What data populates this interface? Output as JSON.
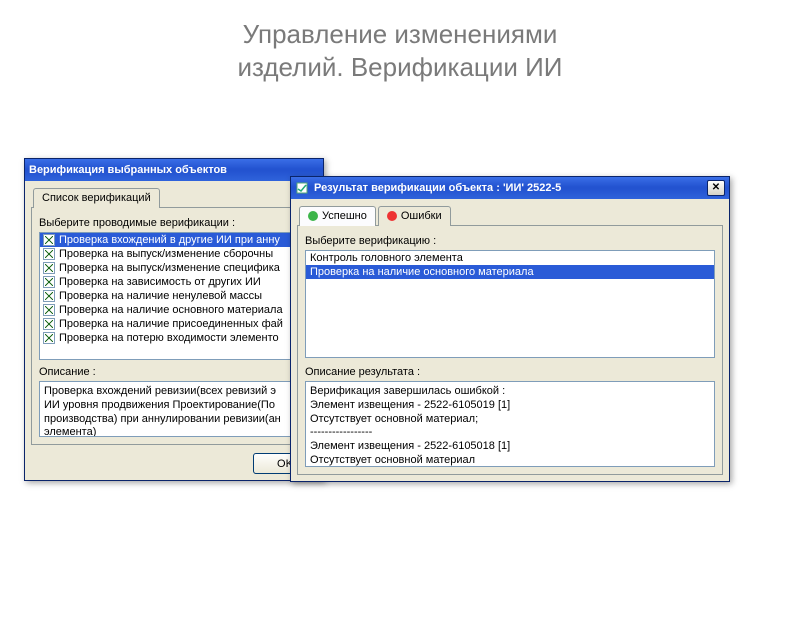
{
  "slide": {
    "title_line1": "Управление изменениями",
    "title_line2": "изделий. Верификации ИИ"
  },
  "win_left": {
    "title": "Верификация выбранных объектов",
    "tab_label": "Список верификаций",
    "prompt": "Выберите проводимые верификации :",
    "items": [
      {
        "checked": true,
        "selected": true,
        "label": "Проверка вхождений в другие ИИ при анну"
      },
      {
        "checked": true,
        "selected": false,
        "label": "Проверка на выпуск/изменение сборочны"
      },
      {
        "checked": true,
        "selected": false,
        "label": "Проверка на выпуск/изменение специфика"
      },
      {
        "checked": true,
        "selected": false,
        "label": "Проверка на зависимость от других ИИ"
      },
      {
        "checked": true,
        "selected": false,
        "label": "Проверка на наличие ненулевой массы"
      },
      {
        "checked": true,
        "selected": false,
        "label": "Проверка на наличие основного материала"
      },
      {
        "checked": true,
        "selected": false,
        "label": "Проверка на наличие присоединенных фай"
      },
      {
        "checked": true,
        "selected": false,
        "label": "Проверка на потерю входимости элементо"
      }
    ],
    "desc_label": "Описание :",
    "desc_text": "Проверка вхождений ревизии(всех ревизий э\nИИ уровня продвижения Проектирование(По\nпроизводства) при аннулировании ревизии(ан\nэлемента)",
    "ok_label": "OK"
  },
  "win_right": {
    "title": "Результат верификации объекта : 'ИИ' 2522-5",
    "tabs": [
      {
        "icon": "ok",
        "label": "Успешно",
        "active": false
      },
      {
        "icon": "err",
        "label": "Ошибки",
        "active": true
      }
    ],
    "prompt1": "Выберите верификацию :",
    "verifications": [
      {
        "selected": false,
        "label": "Контроль головного элемента"
      },
      {
        "selected": true,
        "label": "Проверка на наличие основного материала"
      }
    ],
    "prompt2": "Описание результата :",
    "result_text": "Верификация завершилась ошибкой :\nЭлемент извещения - 2522-6105019 [1]\nОтсутствует основной материал;\n-----------------\nЭлемент извещения - 2522-6105018 [1]\nОтсутствует основной материал"
  }
}
